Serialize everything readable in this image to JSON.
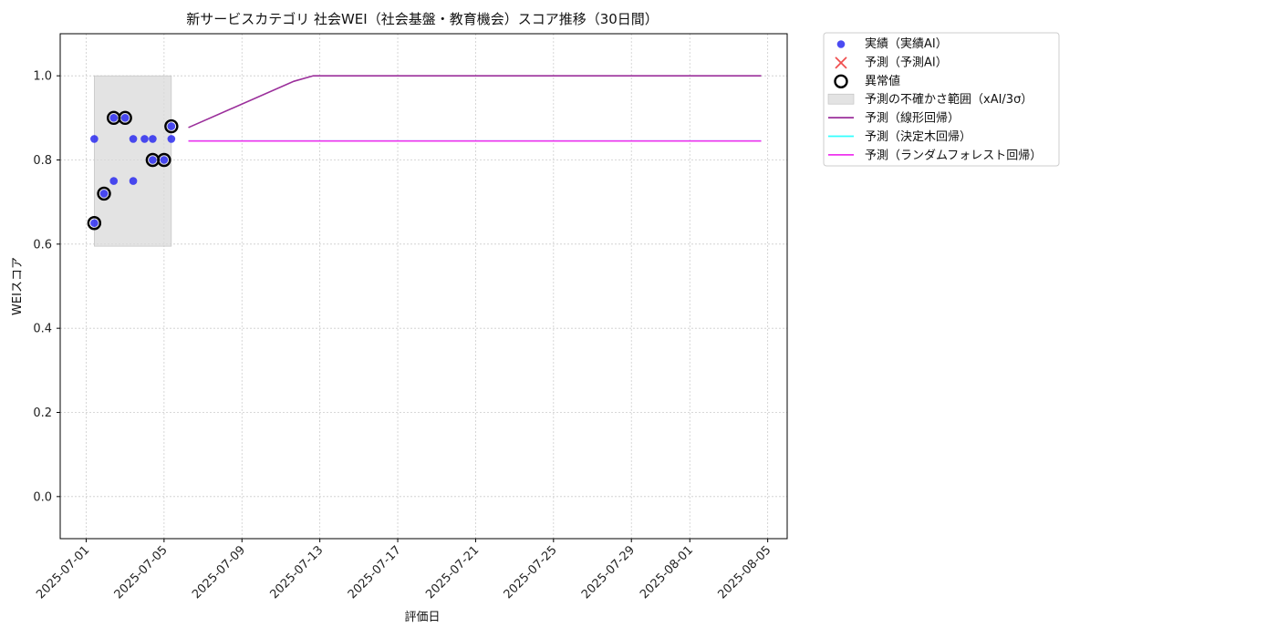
{
  "chart_data": {
    "type": "line",
    "title": "新サービスカテゴリ 社会WEI（社会基盤・教育機会）スコア推移（30日間）",
    "xlabel": "評価日",
    "ylabel": "WEIスコア",
    "x_axis_type": "date",
    "xlim": [
      "2025-06-29 16:00",
      "2025-08-06 00:00"
    ],
    "ylim": [
      -0.1,
      1.1
    ],
    "x_ticks": [
      "2025-07-01",
      "2025-07-05",
      "2025-07-09",
      "2025-07-13",
      "2025-07-17",
      "2025-07-21",
      "2025-07-25",
      "2025-07-29",
      "2025-08-01",
      "2025-08-05"
    ],
    "y_ticks": [
      0.0,
      0.2,
      0.4,
      0.6,
      0.8,
      1.0
    ],
    "y_tick_labels": [
      "0.0",
      "0.2",
      "0.4",
      "0.6",
      "0.8",
      "1.0"
    ],
    "grid": true,
    "legend_placement": "outside-top-right",
    "uncertainty_band": {
      "name": "予測の不確かさ範囲（xAI/3σ）",
      "x_start": "2025-07-01 10:00",
      "x_end": "2025-07-05 09:00",
      "y_low": 0.595,
      "y_high": 1.0,
      "color": "#d9d9d9"
    },
    "series": [
      {
        "name": "実績（実績AI）",
        "kind": "scatter",
        "color": "#2b2bf0",
        "points": [
          [
            "2025-07-01 10:00",
            0.85
          ],
          [
            "2025-07-01 10:00",
            0.65
          ],
          [
            "2025-07-01 22:00",
            0.72
          ],
          [
            "2025-07-02 10:00",
            0.75
          ],
          [
            "2025-07-02 10:00",
            0.9
          ],
          [
            "2025-07-03 00:00",
            0.9
          ],
          [
            "2025-07-03 10:00",
            0.75
          ],
          [
            "2025-07-03 10:00",
            0.85
          ],
          [
            "2025-07-04 00:00",
            0.85
          ],
          [
            "2025-07-04 10:00",
            0.85
          ],
          [
            "2025-07-04 10:00",
            0.8
          ],
          [
            "2025-07-05 00:00",
            0.8
          ],
          [
            "2025-07-05 09:00",
            0.85
          ],
          [
            "2025-07-05 09:00",
            0.88
          ]
        ]
      },
      {
        "name": "予測（予測AI）",
        "kind": "cross",
        "color": "#f05050",
        "points": []
      },
      {
        "name": "異常値",
        "kind": "anomaly",
        "color": "#000000",
        "points": [
          [
            "2025-07-01 10:00",
            0.65
          ],
          [
            "2025-07-01 22:00",
            0.72
          ],
          [
            "2025-07-02 10:00",
            0.9
          ],
          [
            "2025-07-03 00:00",
            0.9
          ],
          [
            "2025-07-04 10:00",
            0.8
          ],
          [
            "2025-07-05 00:00",
            0.8
          ],
          [
            "2025-07-05 09:00",
            0.88
          ]
        ]
      },
      {
        "name": "予測（線形回帰）",
        "kind": "line",
        "color": "#9b2f9b",
        "points": [
          [
            "2025-07-06 06:00",
            0.877
          ],
          [
            "2025-07-11 16:00",
            0.987
          ],
          [
            "2025-07-12 16:00",
            1.0
          ],
          [
            "2025-08-04 16:00",
            1.0
          ]
        ]
      },
      {
        "name": "予測（決定木回帰）",
        "kind": "line",
        "color": "#33ffff",
        "points": [
          [
            "2025-07-06 06:00",
            0.845
          ],
          [
            "2025-08-04 16:00",
            0.845
          ]
        ]
      },
      {
        "name": "予測（ランダムフォレスト回帰）",
        "kind": "line",
        "color": "#ee33ee",
        "points": [
          [
            "2025-07-06 06:00",
            0.845
          ],
          [
            "2025-08-04 16:00",
            0.845
          ]
        ]
      }
    ],
    "legend_order": [
      "実績（実績AI）",
      "予測（予測AI）",
      "異常値",
      "予測の不確かさ範囲（xAI/3σ）",
      "予測（線形回帰）",
      "予測（決定木回帰）",
      "予測（ランダムフォレスト回帰）"
    ]
  }
}
